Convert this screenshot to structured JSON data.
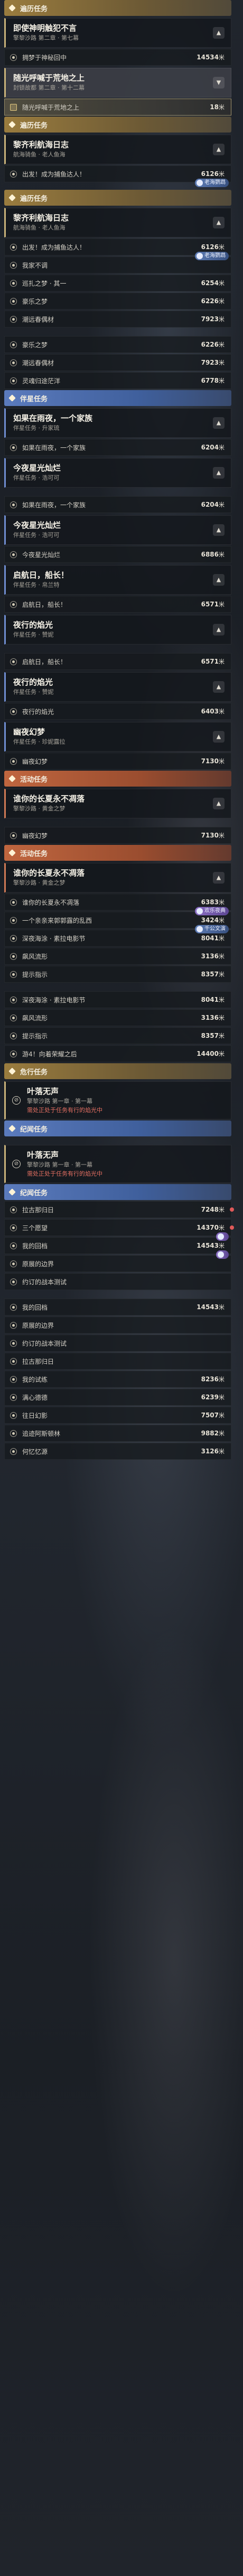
{
  "sections": [
    {
      "header": {
        "color": "gold",
        "title": "遍历任务"
      }
    },
    {
      "card": {
        "color": "gold",
        "title": "即使神明触犯不言",
        "sub": "擎黎沙路 第二章 · 第七幕",
        "collapse": "up"
      }
    },
    {
      "row": {
        "icon": "target",
        "label": "拥梦于神秘回中",
        "dist": "14534",
        "unit": "米"
      }
    },
    {
      "card": {
        "color": "gold",
        "title": "随光呼喊于荒地之上",
        "sub": "封锁故都 第二章 · 第十二幕",
        "collapse": "down",
        "sel": true
      }
    },
    {
      "row": {
        "icon": "sq",
        "label": "随光呼喊于荒地之上",
        "dist": "18",
        "unit": "米",
        "active": true
      }
    },
    {
      "header": {
        "color": "gold",
        "title": "遍历任务"
      }
    },
    {
      "card": {
        "color": "gold",
        "title": "黎齐利航海日志",
        "sub": "航海骑鱼 · 老人鱼海",
        "collapse": "up"
      }
    },
    {
      "row": {
        "icon": "target",
        "label": "出发！成为捕鱼达人！",
        "dist": "6126",
        "unit": "米",
        "badge": "老海鹦鹉",
        "badgeColor": "blue"
      }
    },
    {
      "gapBig": true
    },
    {
      "header": {
        "color": "gold",
        "title": "遍历任务"
      }
    },
    {
      "card": {
        "color": "gold",
        "title": "黎齐利航海日志",
        "sub": "航海骑鱼 · 老人鱼海",
        "collapse": "up"
      }
    },
    {
      "row": {
        "icon": "target",
        "label": "出发！成为捕鱼达人！",
        "dist": "6126",
        "unit": "米",
        "badge": "老海鹦鹉",
        "badgeColor": "blue"
      }
    },
    {
      "row": {
        "icon": "target",
        "label": "我家不调",
        "dist": "",
        "unit": ""
      }
    },
    {
      "row": {
        "icon": "target",
        "label": "巡扎之梦 · 其一",
        "dist": "6254",
        "unit": "米"
      }
    },
    {
      "row": {
        "icon": "target",
        "label": "豪乐之梦",
        "dist": "6226",
        "unit": "米"
      }
    },
    {
      "row": {
        "icon": "target",
        "label": "潮远春偶材",
        "dist": "7923",
        "unit": "米"
      }
    },
    {
      "gapBig": true
    },
    {
      "row": {
        "icon": "target",
        "label": "豪乐之梦",
        "dist": "6226",
        "unit": "米"
      }
    },
    {
      "row": {
        "icon": "target",
        "label": "潮远春偶材",
        "dist": "7923",
        "unit": "米"
      }
    },
    {
      "row": {
        "icon": "target",
        "label": "灵魂归途茫洋",
        "dist": "6778",
        "unit": "米"
      }
    },
    {
      "header": {
        "color": "blue",
        "title": "伴星任务"
      }
    },
    {
      "card": {
        "color": "blue",
        "title": "如果在雨夜，一个家族",
        "sub": "伴星任务 · 升家琉",
        "collapse": "up"
      }
    },
    {
      "row": {
        "icon": "target",
        "label": "如果在雨夜，一个家族",
        "dist": "6204",
        "unit": "米"
      }
    },
    {
      "card": {
        "color": "blue",
        "title": "今夜星光灿烂",
        "sub": "伴星任务 · 浩可可",
        "collapse": "up"
      }
    },
    {
      "gapBig": true
    },
    {
      "row": {
        "icon": "target",
        "label": "如果在雨夜，一个家族",
        "dist": "6204",
        "unit": "米"
      }
    },
    {
      "card": {
        "color": "blue",
        "title": "今夜星光灿烂",
        "sub": "伴星任务 · 浩可可",
        "collapse": "up"
      }
    },
    {
      "row": {
        "icon": "target",
        "label": "今夜星光灿烂",
        "dist": "6886",
        "unit": "米"
      }
    },
    {
      "card": {
        "color": "blue",
        "title": "启航日，船长！",
        "sub": "伴星任务 · 帛兰特",
        "collapse": "up"
      }
    },
    {
      "row": {
        "icon": "target",
        "label": "启航日，船长！",
        "dist": "6571",
        "unit": "米"
      }
    },
    {
      "card": {
        "color": "blue",
        "title": "夜行的焰光",
        "sub": "伴星任务 · 赞妮",
        "collapse": "up"
      }
    },
    {
      "gapBig": true
    },
    {
      "row": {
        "icon": "target",
        "label": "启航日，船长！",
        "dist": "6571",
        "unit": "米"
      }
    },
    {
      "card": {
        "color": "blue",
        "title": "夜行的焰光",
        "sub": "伴星任务 · 赞妮",
        "collapse": "up"
      }
    },
    {
      "row": {
        "icon": "target",
        "label": "夜行的焰光",
        "dist": "6403",
        "unit": "米"
      }
    },
    {
      "card": {
        "color": "blue",
        "title": "幽夜幻梦",
        "sub": "伴星任务 · 珍妮露拉",
        "collapse": "up"
      }
    },
    {
      "row": {
        "icon": "target",
        "label": "幽夜幻梦",
        "dist": "7130",
        "unit": "米"
      }
    },
    {
      "header": {
        "color": "red",
        "title": "活动任务"
      }
    },
    {
      "card": {
        "color": "red",
        "title": "谁你的长夏永不凋落",
        "sub": "擎黎沙路 · 黄金之梦",
        "collapse": "up"
      }
    },
    {
      "gapBig": true
    },
    {
      "row": {
        "icon": "target",
        "label": "幽夜幻梦",
        "dist": "7130",
        "unit": "米"
      }
    },
    {
      "header": {
        "color": "red",
        "title": "活动任务"
      }
    },
    {
      "card": {
        "color": "red",
        "title": "谁你的长夏永不凋落",
        "sub": "擎黎沙路 · 黄金之梦",
        "collapse": "up"
      }
    },
    {
      "row": {
        "icon": "target",
        "label": "谁你的长夏永不凋落",
        "dist": "6383",
        "unit": "米",
        "badge": "欢乐夜典",
        "badgeColor": "purple"
      }
    },
    {
      "row": {
        "icon": "target",
        "label": "一个亲亲来郭郭露的乱西",
        "dist": "3424",
        "unit": "米",
        "badge": "千公文演",
        "badgeColor": "blue"
      }
    },
    {
      "row": {
        "icon": "target",
        "label": "深夜海涂 · 素拉电影节",
        "dist": "8041",
        "unit": "米"
      }
    },
    {
      "row": {
        "icon": "target",
        "label": "飙风流形",
        "dist": "3136",
        "unit": "米"
      }
    },
    {
      "row": {
        "icon": "target",
        "label": "提示指示",
        "dist": "8357",
        "unit": "米"
      }
    },
    {
      "gapBig": true
    },
    {
      "row": {
        "icon": "target",
        "label": "深夜海涂 · 素拉电影节",
        "dist": "8041",
        "unit": "米"
      }
    },
    {
      "row": {
        "icon": "target",
        "label": "飙风流形",
        "dist": "3136",
        "unit": "米"
      }
    },
    {
      "row": {
        "icon": "target",
        "label": "提示指示",
        "dist": "8357",
        "unit": "米"
      }
    },
    {
      "row": {
        "icon": "target",
        "label": "游4！向着荣耀之后",
        "dist": "14400",
        "unit": "米"
      }
    },
    {
      "header": {
        "color": "gold",
        "title": "危行任务"
      }
    },
    {
      "warncard": {
        "color": "gold",
        "title": "叶落无声",
        "sub": "擎黎沙路 第一章 · 第一幕",
        "warn": "需处正处于任务有行的焰光中"
      }
    },
    {
      "header": {
        "color": "blue",
        "title": "纪闻任务"
      }
    },
    {
      "gapBig": true
    },
    {
      "warncard": {
        "color": "gold",
        "title": "叶落无声",
        "sub": "擎黎沙路 第一章 · 第一幕",
        "warn": "需处正处于任务有行的焰光中"
      }
    },
    {
      "header": {
        "color": "blue",
        "title": "纪闻任务"
      }
    },
    {
      "row": {
        "icon": "target",
        "label": "拉古那归日",
        "dist": "7248",
        "unit": "米",
        "dot": true
      }
    },
    {
      "row": {
        "icon": "target",
        "label": "三个愿望",
        "dist": "14370",
        "unit": "米",
        "badge": "",
        "badgeColor": "purple",
        "dot": true
      }
    },
    {
      "row": {
        "icon": "target",
        "label": "我的回档",
        "dist": "14543",
        "unit": "米",
        "badge": "",
        "badgeColor": "purple"
      }
    },
    {
      "row": {
        "icon": "target",
        "label": "原展的边界",
        "dist": "",
        "unit": ""
      }
    },
    {
      "row": {
        "icon": "target",
        "label": "约订的战本测试",
        "dist": "",
        "unit": ""
      }
    },
    {
      "gapBig": true
    },
    {
      "row": {
        "icon": "target",
        "label": "我的回档",
        "dist": "14543",
        "unit": "米"
      }
    },
    {
      "row": {
        "icon": "target",
        "label": "原展的边界",
        "dist": "",
        "unit": ""
      }
    },
    {
      "row": {
        "icon": "target",
        "label": "约订的战本测试",
        "dist": "",
        "unit": ""
      }
    },
    {
      "row": {
        "icon": "target",
        "label": "拉古那归日",
        "dist": "",
        "unit": ""
      }
    },
    {
      "row": {
        "icon": "target",
        "label": "我的试练",
        "dist": "8236",
        "unit": "米"
      }
    },
    {
      "row": {
        "icon": "target",
        "label": "满心德德",
        "dist": "6239",
        "unit": "米"
      }
    },
    {
      "row": {
        "icon": "target",
        "label": "往日幻影",
        "dist": "7507",
        "unit": "米"
      }
    },
    {
      "row": {
        "icon": "target",
        "label": "追迹阿斯顿林",
        "dist": "9882",
        "unit": "米"
      }
    },
    {
      "row": {
        "icon": "target",
        "label": "何忆忆源",
        "dist": "3126",
        "unit": "米"
      }
    }
  ]
}
